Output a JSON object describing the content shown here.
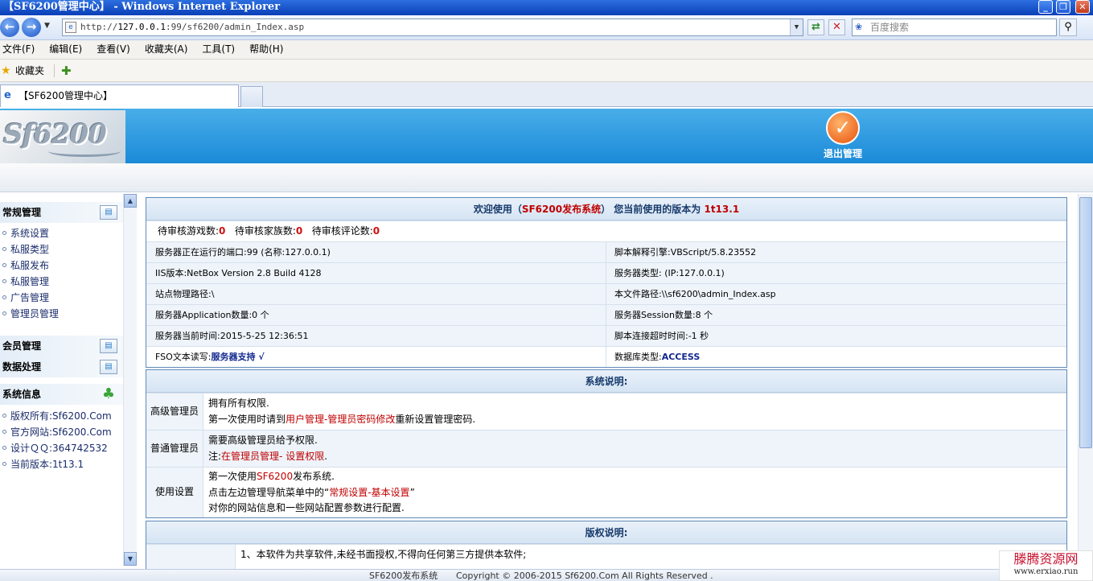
{
  "window": {
    "title": "【SF6200管理中心】 - Windows Internet Explorer"
  },
  "browser": {
    "address_prefix": "http://",
    "address_host": "127.0.0.1",
    "address_rest": ":99/sf6200/admin_Index.asp",
    "search_placeholder": "百度搜索",
    "menu": [
      "文件(F)",
      "编辑(E)",
      "查看(V)",
      "收藏夹(A)",
      "工具(T)",
      "帮助(H)"
    ],
    "favorites_label": "收藏夹",
    "tab_title": "【SF6200管理中心】"
  },
  "header": {
    "logo_text": "Sf6200",
    "exit_label": "退出管理"
  },
  "sidebar": {
    "sections": [
      {
        "title": "常规管理",
        "items": [
          "系统设置",
          "私服类型",
          "私服发布",
          "私服管理",
          "广告管理",
          "管理员管理"
        ]
      },
      {
        "title": "会员管理",
        "items": []
      },
      {
        "title": "数据处理",
        "items": []
      },
      {
        "title": "系统信息",
        "items": [
          "版权所有:Sf6200.Com",
          "官方网站:Sf6200.Com",
          "设计ＱＱ:364742532",
          "当前版本:1t13.1"
        ]
      }
    ]
  },
  "welcome": {
    "pre": "欢迎使用（",
    "system": "SF6200发布系统",
    "mid": "）  您当前使用的版本为",
    "version": "1t13.1"
  },
  "pending": [
    {
      "label": "待审核游戏数:",
      "count": "0"
    },
    {
      "label": "待审核家族数:",
      "count": "0"
    },
    {
      "label": "待审核评论数:",
      "count": "0"
    }
  ],
  "server_info": [
    {
      "left": "服务器正在运行的端口:99 (名称:127.0.0.1)",
      "right": "脚本解释引擎:VBScript/5.8.23552"
    },
    {
      "left": "IIS版本:NetBox Version 2.8 Build 4128",
      "right": "服务器类型: (IP:127.0.0.1)"
    },
    {
      "left": "站点物理路径:\\",
      "right": "本文件路径:\\\\sf6200\\admin_Index.asp"
    },
    {
      "left": "服务器Application数量:0 个",
      "right": "服务器Session数量:8 个"
    },
    {
      "left": "服务器当前时间:2015-5-25 12:36:51",
      "right": "脚本连接超时时间:-1 秒"
    }
  ],
  "fso": {
    "label": "FSO文本读写:",
    "value": "服务器支持 √"
  },
  "db": {
    "label": "数据库类型:",
    "value": "ACCESS"
  },
  "sysdesc": {
    "title": "系统说明:",
    "rows": [
      {
        "label": "高级管理员",
        "line1": "拥有所有权限.",
        "line2_pre": "第一次使用时请到",
        "line2_red": "用户管理-管理员密码修改",
        "line2_post": "重新设置管理密码."
      },
      {
        "label": "普通管理员",
        "line1": "需要高级管理员给予权限.",
        "line2_pre": "注:",
        "line2_red": "在管理员管理- 设置权限",
        "line2_post": "."
      },
      {
        "label": "使用设置",
        "line1_pre": "第一次使用",
        "line1_red": "SF6200",
        "line1_post": "发布系统.",
        "line2_pre": "点击左边管理导航菜单中的“",
        "line2_red": "常规设置-基本设置",
        "line2_post": "”",
        "line3": "对你的网站信息和一些网站配置参数进行配置."
      }
    ]
  },
  "copyright": {
    "title": "版权说明:",
    "line1": "1、本软件为共享软件,未经书面授权,不得向任何第三方提供本软件;"
  },
  "footer": {
    "system": "SF6200发布系统",
    "copy": "Copyright © 2006-2015 Sf6200.Com All Rights Reserved ."
  },
  "watermark": {
    "line1": "滕腾资源网",
    "line2": "www.erxiao.run"
  }
}
